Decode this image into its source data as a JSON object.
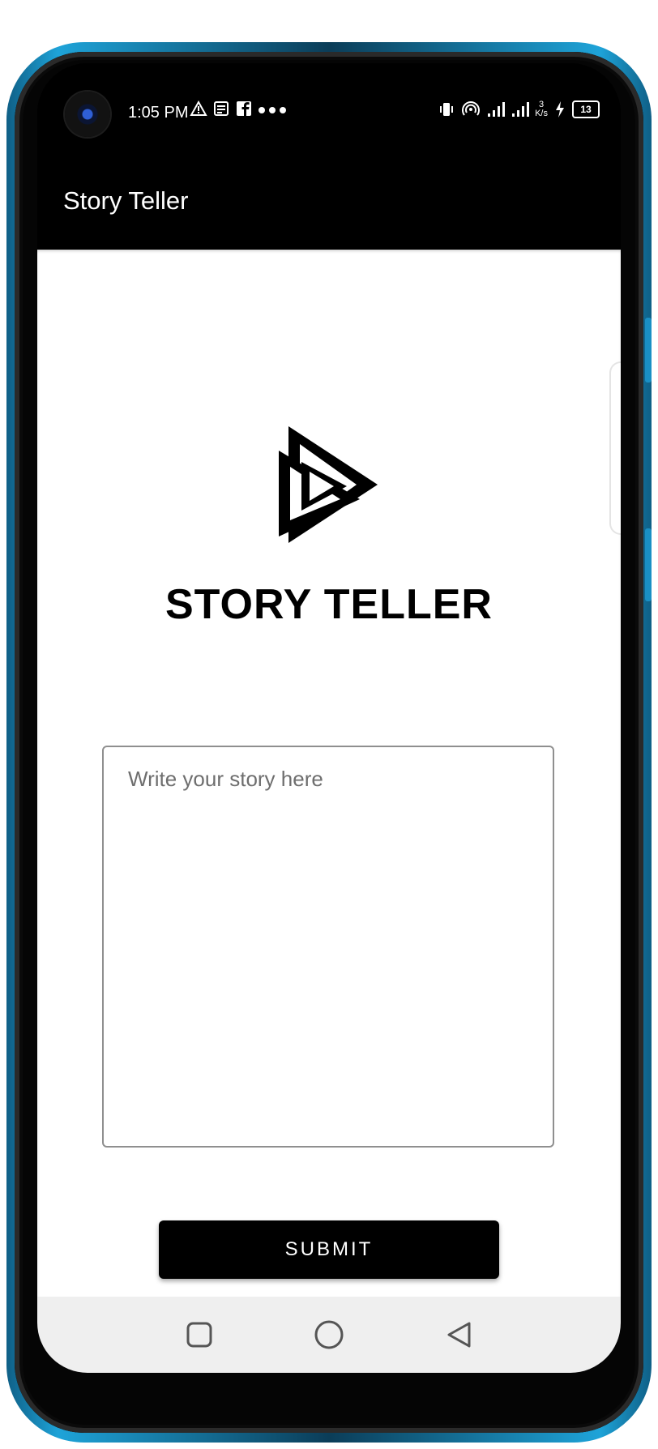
{
  "status_bar": {
    "time": "1:05 PM",
    "data_speed_value": "3",
    "data_speed_unit": "K/s",
    "battery": "13"
  },
  "app_bar": {
    "title": "Story Teller"
  },
  "main": {
    "headline": "STORY TELLER",
    "story_input": {
      "placeholder": "Write your story here",
      "value": ""
    },
    "submit_label": "SUBMIT"
  },
  "icons": {
    "status_left": [
      "warning-icon",
      "news-icon",
      "facebook-icon",
      "more-dots-icon"
    ],
    "status_right": [
      "vibrate-icon",
      "hotspot-icon",
      "signal-icon",
      "signal-icon",
      "data-speed-icon",
      "charging-icon",
      "battery-icon"
    ],
    "nav": [
      "recents-icon",
      "home-icon",
      "back-icon"
    ]
  },
  "colors": {
    "app_bar": "#000000",
    "button": "#000000",
    "frame_accent": "#1ea3d8"
  }
}
